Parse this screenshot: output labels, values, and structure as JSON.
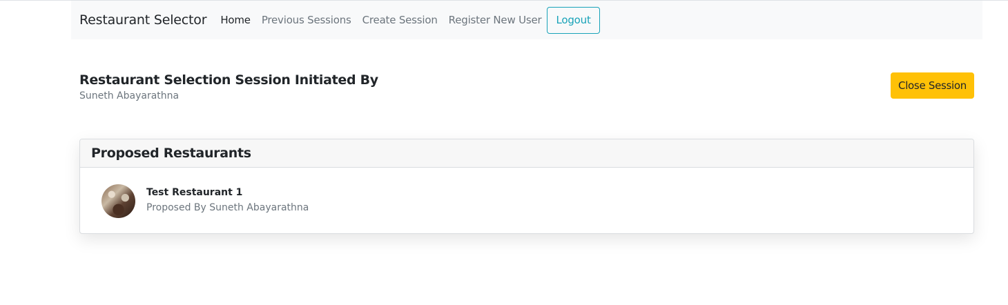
{
  "navbar": {
    "brand": "Restaurant Selector",
    "links": [
      {
        "label": "Home",
        "active": true
      },
      {
        "label": "Previous Sessions",
        "active": false
      },
      {
        "label": "Create Session",
        "active": false
      },
      {
        "label": "Register New User",
        "active": false
      }
    ],
    "logout_label": "Logout"
  },
  "session": {
    "title": "Restaurant Selection Session Initiated By",
    "initiator": "Suneth Abayarathna",
    "close_label": "Close Session"
  },
  "proposals": {
    "header": "Proposed Restaurants",
    "items": [
      {
        "name": "Test Restaurant 1",
        "proposed_by": "Proposed By Suneth Abayarathna"
      }
    ]
  },
  "colors": {
    "navbar_bg": "#f8f9fa",
    "logout_accent": "#17a2b8",
    "close_button": "#ffc107",
    "muted_text": "#6c757d"
  }
}
